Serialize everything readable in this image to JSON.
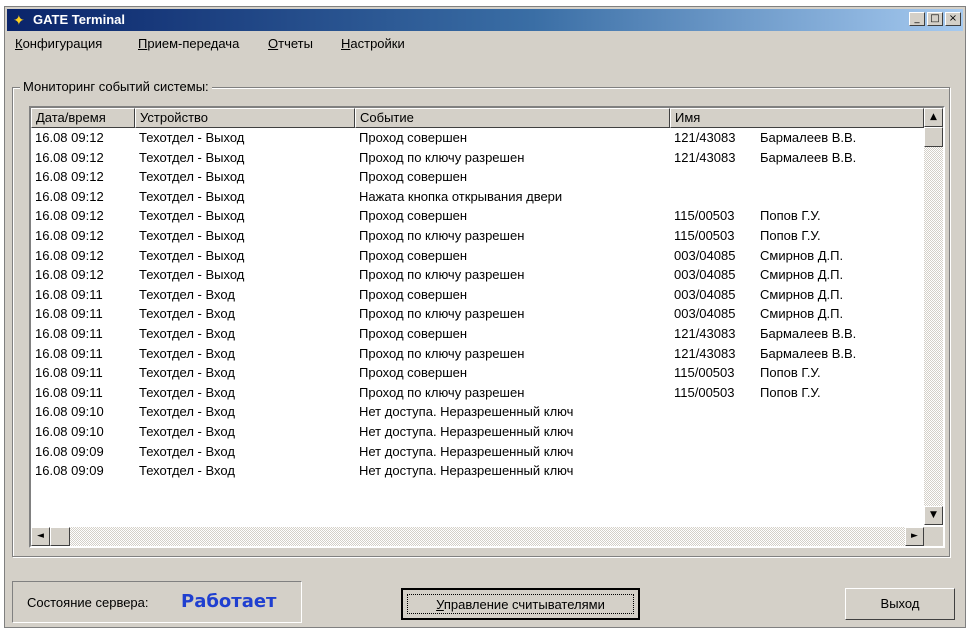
{
  "window": {
    "title": "GATE Terminal",
    "minimize": "_",
    "maximize": "□",
    "close": "×"
  },
  "menu": [
    {
      "first": "К",
      "rest": "онфигурация"
    },
    {
      "first": "П",
      "rest": "рием-передача"
    },
    {
      "first": "О",
      "rest": "тчеты"
    },
    {
      "first": "Н",
      "rest": "астройки"
    }
  ],
  "monitor": {
    "label": "Мониторинг событий системы:",
    "columns": [
      "Дата/время",
      "Устройство",
      "Событие",
      "Имя"
    ],
    "rows": [
      [
        "16.08  09:12",
        "Техотдел - Выход",
        "Проход совершен",
        "121/43083",
        "Бармалеев В.В."
      ],
      [
        "16.08  09:12",
        "Техотдел - Выход",
        "Проход по ключу разрешен",
        "121/43083",
        "Бармалеев В.В."
      ],
      [
        "16.08  09:12",
        "Техотдел - Выход",
        "Проход совершен",
        "",
        ""
      ],
      [
        "16.08  09:12",
        "Техотдел - Выход",
        "Нажата кнопка открывания двери",
        "",
        ""
      ],
      [
        "16.08  09:12",
        "Техотдел - Выход",
        "Проход совершен",
        "115/00503",
        "Попов Г.У."
      ],
      [
        "16.08  09:12",
        "Техотдел - Выход",
        "Проход по ключу разрешен",
        "115/00503",
        "Попов Г.У."
      ],
      [
        "16.08  09:12",
        "Техотдел - Выход",
        "Проход совершен",
        "003/04085",
        "Смирнов Д.П."
      ],
      [
        "16.08  09:12",
        "Техотдел - Выход",
        "Проход по ключу разрешен",
        "003/04085",
        "Смирнов Д.П."
      ],
      [
        "16.08  09:11",
        "Техотдел - Вход",
        "Проход совершен",
        "003/04085",
        "Смирнов Д.П."
      ],
      [
        "16.08  09:11",
        "Техотдел - Вход",
        "Проход по ключу разрешен",
        "003/04085",
        "Смирнов Д.П."
      ],
      [
        "16.08  09:11",
        "Техотдел - Вход",
        "Проход совершен",
        "121/43083",
        "Бармалеев В.В."
      ],
      [
        "16.08  09:11",
        "Техотдел - Вход",
        "Проход по ключу разрешен",
        "121/43083",
        "Бармалеев В.В."
      ],
      [
        "16.08  09:11",
        "Техотдел - Вход",
        "Проход совершен",
        "115/00503",
        "Попов Г.У."
      ],
      [
        "16.08  09:11",
        "Техотдел - Вход",
        "Проход по ключу разрешен",
        "115/00503",
        "Попов Г.У."
      ],
      [
        "16.08  09:10",
        "Техотдел - Вход",
        "Нет доступа. Неразрешенный ключ",
        "",
        ""
      ],
      [
        "16.08  09:10",
        "Техотдел - Вход",
        "Нет доступа. Неразрешенный ключ",
        "",
        ""
      ],
      [
        "16.08  09:09",
        "Техотдел - Вход",
        "Нет доступа. Неразрешенный ключ",
        "",
        ""
      ],
      [
        "16.08  09:09",
        "Техотдел - Вход",
        "Нет доступа. Неразрешенный ключ",
        "",
        ""
      ]
    ]
  },
  "scroll": {
    "up": "▲",
    "down": "▼",
    "left": "◄",
    "right": "►"
  },
  "status": {
    "label": "Состояние сервера:",
    "value": "Работает",
    "value_color": "#1f3fd0"
  },
  "buttons": {
    "readers": {
      "first": "У",
      "rest": "правление считывателями"
    },
    "exit": "Выход"
  }
}
